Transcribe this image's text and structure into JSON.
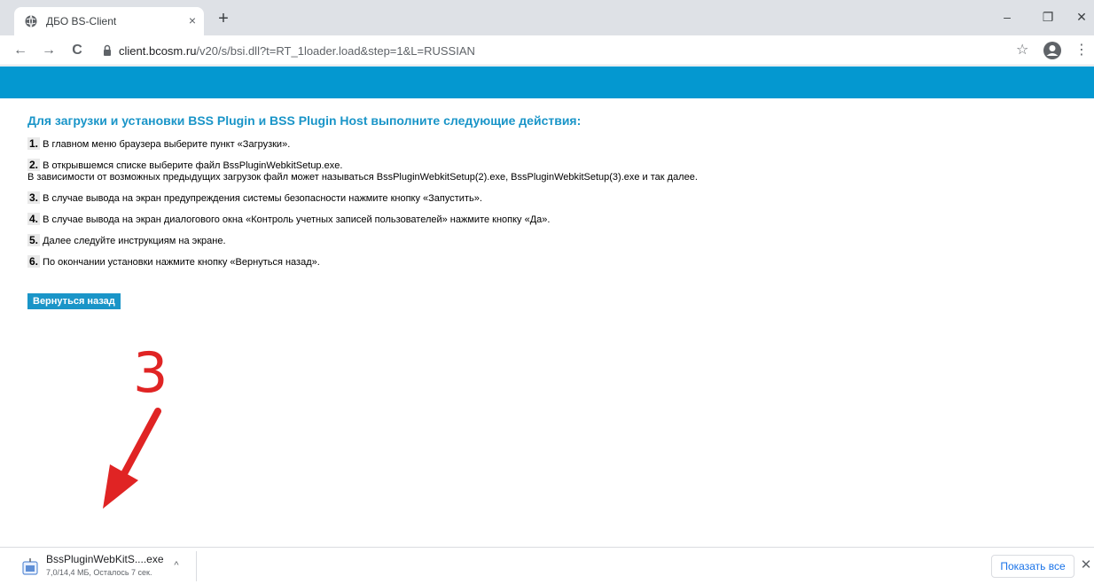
{
  "browser": {
    "tab_title": "ДБО BS-Client",
    "close_tab_glyph": "×",
    "new_tab_glyph": "+",
    "minimize_glyph": "–",
    "restore_glyph": "❐",
    "close_window_glyph": "✕",
    "back_glyph": "←",
    "forward_glyph": "→",
    "reload_glyph": "C",
    "url_host": "client.bcosm.ru",
    "url_path": "/v20/s/bsi.dll?t=RT_1loader.load&step=1&L=RUSSIAN",
    "star_glyph": "☆",
    "menu_glyph": "⋮"
  },
  "page": {
    "heading": "Для загрузки и установки BSS Plugin и BSS Plugin Host выполните следующие действия:",
    "steps": [
      {
        "num": "1.",
        "text": " В главном меню браузера выберите пункт «Загрузки»."
      },
      {
        "num": "2.",
        "text": " В открывшемся списке выберите файл BssPluginWebkitSetup.exe.",
        "note": "В зависимости от возможных предыдущих загрузок файл может называться BssPluginWebkitSetup(2).exe, BssPluginWebkitSetup(3).exe и так далее."
      },
      {
        "num": "3.",
        "text": " В случае вывода на экран предупреждения системы безопасности нажмите кнопку «Запустить»."
      },
      {
        "num": "4.",
        "text": " В случае вывода на экран диалогового окна «Контроль учетных записей пользователей» нажмите кнопку «Да»."
      },
      {
        "num": "5.",
        "text": " Далее следуйте инструкциям на экране."
      },
      {
        "num": "6.",
        "text": " По окончании установки нажмите кнопку «Вернуться назад»."
      }
    ],
    "back_button": "Вернуться назад"
  },
  "annotation": {
    "number": "3",
    "color": "#e02424"
  },
  "downloads": {
    "file_name": "BssPluginWebKitS....exe",
    "status": "7,0/14,4 МБ, Осталось 7 сек.",
    "chevron_glyph": "^",
    "show_all": "Показать все",
    "close_glyph": "✕"
  },
  "colors": {
    "banner": "#0498d0",
    "heading": "#1a95c8",
    "button": "#1a95c8"
  }
}
